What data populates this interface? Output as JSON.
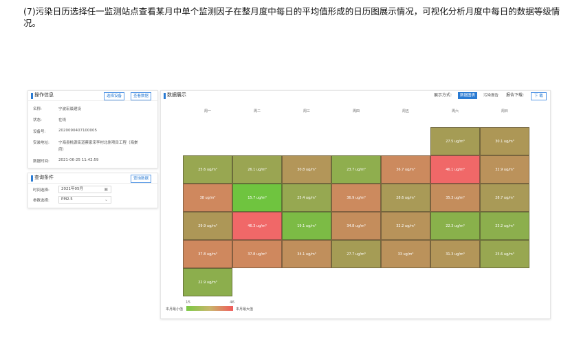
{
  "caption": "(7)污染日历选择任一监测站点查看某月中单个监测因子在整月度中每日的平均值形成的日历图展示情况，可视化分析月度中每日的数据等级情况。",
  "info_panel": {
    "title": "操作信息",
    "btn_select": "选择设备",
    "btn_view": "查看数据",
    "fields": [
      {
        "label": "名称:",
        "value": "宁波宏晨建设"
      },
      {
        "label": "状态:",
        "value": "在线"
      },
      {
        "label": "设备号:",
        "value": "2020090407100005"
      },
      {
        "label": "安装地址:",
        "value": "宁海县桃源街道蔡家宋李村北侧项目工程（海棠"
      },
      {
        "label": "",
        "value": "府）"
      },
      {
        "label": "数据时间:",
        "value": "2021-06-25 11:42:59"
      }
    ]
  },
  "query_panel": {
    "title": "查询条件",
    "btn_query": "查询数据",
    "time_label": "时间选择:",
    "time_value": "2021年05月",
    "param_label": "参数选择:",
    "param_value": "PM2.5",
    "calendar_icon": "calendar-icon",
    "dropdown_icon": "chevron-down-icon"
  },
  "main": {
    "title": "数据展示",
    "mode_label": "展示方式:",
    "tab_calendar": "数据图表",
    "tab_report": "污染报告",
    "report_dl_label": "报告下载:",
    "download": "下 载",
    "weekdays": [
      "周一",
      "周二",
      "周三",
      "周四",
      "周五",
      "周六",
      "周日"
    ],
    "cells": [
      {
        "row": 0,
        "col": 5,
        "text": "27.5 ug/m³",
        "color": "#a59c55"
      },
      {
        "row": 0,
        "col": 6,
        "text": "30.1 ug/m³",
        "color": "#ad9756"
      },
      {
        "row": 1,
        "col": 0,
        "text": "25.6 ug/m³",
        "color": "#98a751"
      },
      {
        "row": 1,
        "col": 1,
        "text": "26.1 ug/m³",
        "color": "#9aa552"
      },
      {
        "row": 1,
        "col": 2,
        "text": "30.8 ug/m³",
        "color": "#b39659"
      },
      {
        "row": 1,
        "col": 3,
        "text": "23.7 ug/m³",
        "color": "#8fae4e"
      },
      {
        "row": 1,
        "col": 4,
        "text": "36.7 ug/m³",
        "color": "#cc8a5e"
      },
      {
        "row": 1,
        "col": 5,
        "text": "46.1 ug/m³",
        "color": "#f06868"
      },
      {
        "row": 1,
        "col": 6,
        "text": "32.9 ug/m³",
        "color": "#bb925b"
      },
      {
        "row": 2,
        "col": 0,
        "text": "38 ug/m³",
        "color": "#cf885e"
      },
      {
        "row": 2,
        "col": 1,
        "text": "15.7 ug/m³",
        "color": "#6fc43f"
      },
      {
        "row": 2,
        "col": 2,
        "text": "25.4 ug/m³",
        "color": "#96a851"
      },
      {
        "row": 2,
        "col": 3,
        "text": "36.9 ug/m³",
        "color": "#cc8a5e"
      },
      {
        "row": 2,
        "col": 4,
        "text": "28.6 ug/m³",
        "color": "#a99a57"
      },
      {
        "row": 2,
        "col": 5,
        "text": "35.3 ug/m³",
        "color": "#c48d5c"
      },
      {
        "row": 2,
        "col": 6,
        "text": "28.7 ug/m³",
        "color": "#a99a57"
      },
      {
        "row": 3,
        "col": 0,
        "text": "29.9 ug/m³",
        "color": "#ad9757"
      },
      {
        "row": 3,
        "col": 1,
        "text": "46.3 ug/m³",
        "color": "#f06868"
      },
      {
        "row": 3,
        "col": 2,
        "text": "19.1 ug/m³",
        "color": "#7cbb45"
      },
      {
        "row": 3,
        "col": 3,
        "text": "34.8 ug/m³",
        "color": "#c48d5c"
      },
      {
        "row": 3,
        "col": 4,
        "text": "32.2 ug/m³",
        "color": "#b8935a"
      },
      {
        "row": 3,
        "col": 5,
        "text": "22.3 ug/m³",
        "color": "#89b14b"
      },
      {
        "row": 3,
        "col": 6,
        "text": "23.2 ug/m³",
        "color": "#8caf4d"
      },
      {
        "row": 4,
        "col": 0,
        "text": "37.8 ug/m³",
        "color": "#cf885e"
      },
      {
        "row": 4,
        "col": 1,
        "text": "37.8 ug/m³",
        "color": "#cf885e"
      },
      {
        "row": 4,
        "col": 2,
        "text": "34.1 ug/m³",
        "color": "#c08f5c"
      },
      {
        "row": 4,
        "col": 3,
        "text": "27.7 ug/m³",
        "color": "#a59c55"
      },
      {
        "row": 4,
        "col": 4,
        "text": "33 ug/m³",
        "color": "#bb925b"
      },
      {
        "row": 4,
        "col": 5,
        "text": "31.3 ug/m³",
        "color": "#b39659"
      },
      {
        "row": 4,
        "col": 6,
        "text": "25.6 ug/m³",
        "color": "#98a751"
      },
      {
        "row": 5,
        "col": 0,
        "text": "22.9 ug/m³",
        "color": "#8cae4d"
      }
    ],
    "legend": {
      "min_value": "15",
      "max_value": "46",
      "min_label": "本月最小值",
      "max_label": "本月最大值"
    }
  }
}
